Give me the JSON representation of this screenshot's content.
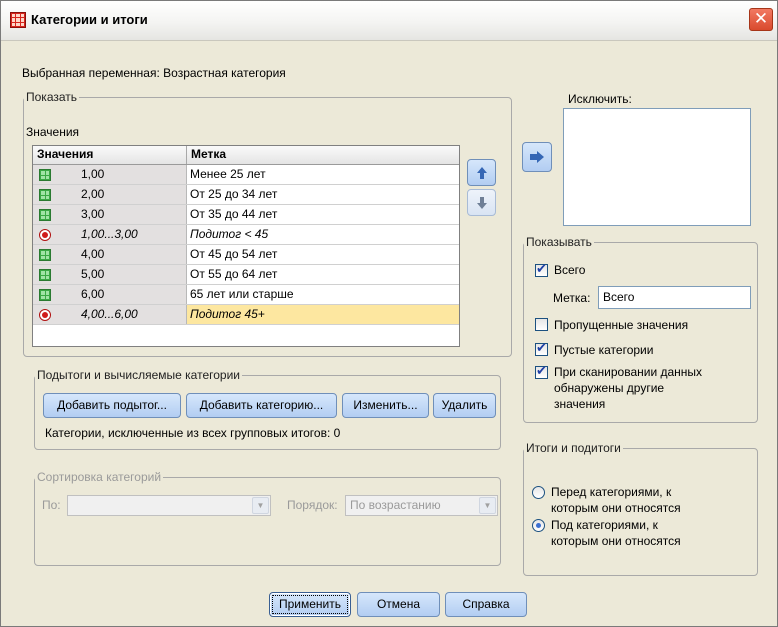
{
  "window": {
    "title": "Категории и итоги",
    "close_glyph": "✕"
  },
  "selected_variable": "Выбранная переменная: Возрастная категория",
  "show_group": {
    "legend": "Показать",
    "values_label": "Значения",
    "table": {
      "headers": [
        "Значения",
        "Метка"
      ],
      "rows": [
        {
          "value": "1,00",
          "label": "Менее 25 лет",
          "kind": "category",
          "icon": "category-grid-icon"
        },
        {
          "value": "2,00",
          "label": "От 25 до 34 лет",
          "kind": "category",
          "icon": "category-grid-icon"
        },
        {
          "value": "3,00",
          "label": "От 35 до 44 лет",
          "kind": "category",
          "icon": "category-grid-icon"
        },
        {
          "value": "1,00...3,00",
          "label": "Подитог < 45",
          "kind": "subtotal",
          "icon": "subtotal-icon"
        },
        {
          "value": "4,00",
          "label": "От 45 до 54 лет",
          "kind": "category",
          "icon": "category-grid-icon"
        },
        {
          "value": "5,00",
          "label": "От 55 до 64 лет",
          "kind": "category",
          "icon": "category-grid-icon"
        },
        {
          "value": "6,00",
          "label": "65 лет или старше",
          "kind": "category",
          "icon": "category-grid-icon"
        },
        {
          "value": "4,00...6,00",
          "label": "Подитог 45+",
          "kind": "subtotal",
          "icon": "subtotal-icon",
          "selected": true
        }
      ]
    }
  },
  "exclude": {
    "label": "Исключить:"
  },
  "subtotals_group": {
    "legend": "Подытоги и вычисляемые категории",
    "buttons": {
      "add_subtotal": "Добавить подытог...",
      "add_category": "Добавить категорию...",
      "edit": "Изменить...",
      "delete": "Удалить"
    },
    "excluded_info": "Категории, исключенные из всех групповых итогов: 0"
  },
  "sort_group": {
    "legend": "Сортировка категорий",
    "by_label": "По:",
    "by_value": "",
    "order_label": "Порядок:",
    "order_value": "По возрастанию"
  },
  "display_group": {
    "legend": "Показывать",
    "total": {
      "label": "Всего",
      "checked": true
    },
    "label_field": {
      "label": "Метка:",
      "value": "Всего"
    },
    "missing": {
      "label": "Пропущенные значения",
      "checked": false
    },
    "empty": {
      "label": "Пустые категории",
      "checked": true
    },
    "other_line1": "При сканировании данных",
    "other_line2": "обнаружены другие",
    "other_line3": "значения",
    "other_checked": true
  },
  "totals_group": {
    "legend": "Итоги и подитоги",
    "before_line1": "Перед категориями, к",
    "before_line2": "которым они относятся",
    "after_line1": "Под категориями, к",
    "after_line2": "которым они относятся",
    "selected": "after"
  },
  "footer": {
    "apply": "Применить",
    "cancel": "Отмена",
    "help": "Справка"
  },
  "colors": {
    "selected_row": "#fde7a0",
    "button_top": "#d6e7fb",
    "button_bottom": "#b2cdf2"
  }
}
